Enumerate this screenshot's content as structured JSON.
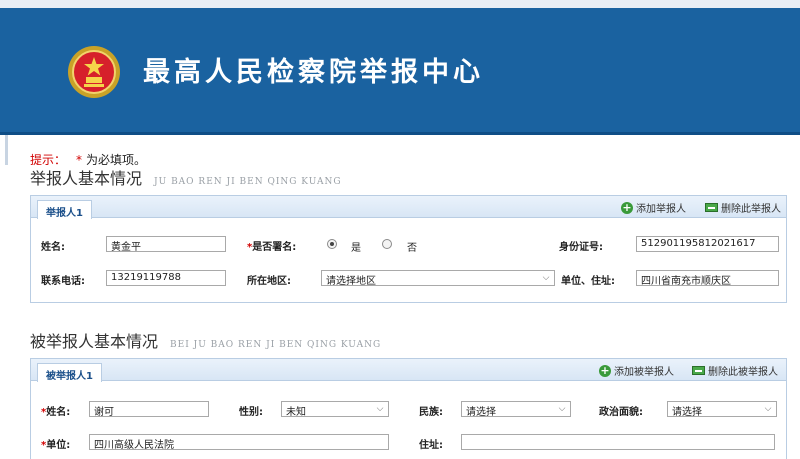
{
  "header": {
    "title": "最高人民检察院举报中心"
  },
  "hint": {
    "prefix": "提示：",
    "star": "*",
    "text": "为必填项。"
  },
  "reporter_section": {
    "title": "举报人基本情况",
    "pinyin": "JU BAO REN JI BEN QING KUANG",
    "tab": "举报人1",
    "add_label": "添加举报人",
    "delete_label": "删除此举报人",
    "fields": {
      "name_label": "姓名:",
      "name_value": "黄金平",
      "signed_label": "是否署名:",
      "signed_yes": "是",
      "signed_no": "否",
      "signed_selected": "是",
      "id_label": "身份证号:",
      "id_value": "512901195812021617",
      "phone_label": "联系电话:",
      "phone_value": "13219119788",
      "region_label": "所在地区:",
      "region_value": "请选择地区",
      "address_label": "单位、住址:",
      "address_value": "四川省南充市顺庆区"
    }
  },
  "reported_section": {
    "title": "被举报人基本情况",
    "pinyin": "BEI JU BAO REN JI BEN QING KUANG",
    "tab": "被举报人1",
    "add_label": "添加被举报人",
    "delete_label": "删除此被举报人",
    "fields": {
      "name_label": "姓名:",
      "name_value": "谢可",
      "gender_label": "性别:",
      "gender_value": "未知",
      "ethnicity_label": "民族:",
      "ethnicity_value": "请选择",
      "political_label": "政治面貌:",
      "political_value": "请选择",
      "unit_label": "单位:",
      "unit_value": "四川高级人民法院",
      "address_label": "住址:",
      "address_value": ""
    }
  },
  "colors": {
    "header_bg": "#1a62a0",
    "required": "#d10000",
    "panel_border": "#b9cde3"
  },
  "icons": {
    "emblem": "national-emblem-icon",
    "add": "plus-circle-icon",
    "delete": "minus-box-icon",
    "dropdown": "chevron-down-icon"
  }
}
